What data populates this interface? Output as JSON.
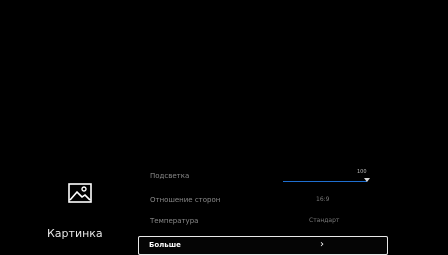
{
  "category": {
    "label": "Картинка",
    "icon": "picture-icon"
  },
  "menu": {
    "backlight": {
      "label": "Подсветка",
      "value": "100",
      "level": 1.0
    },
    "aspect_ratio": {
      "label": "Отношение сторон",
      "value": "16:9"
    },
    "temperature": {
      "label": "Температура",
      "value": "Стандарт"
    },
    "more": {
      "label": "Больше",
      "chevron": "›"
    }
  },
  "colors": {
    "background": "#000000",
    "slider_fill": "#1f6fd1",
    "focus_border": "#e8e8e8"
  }
}
